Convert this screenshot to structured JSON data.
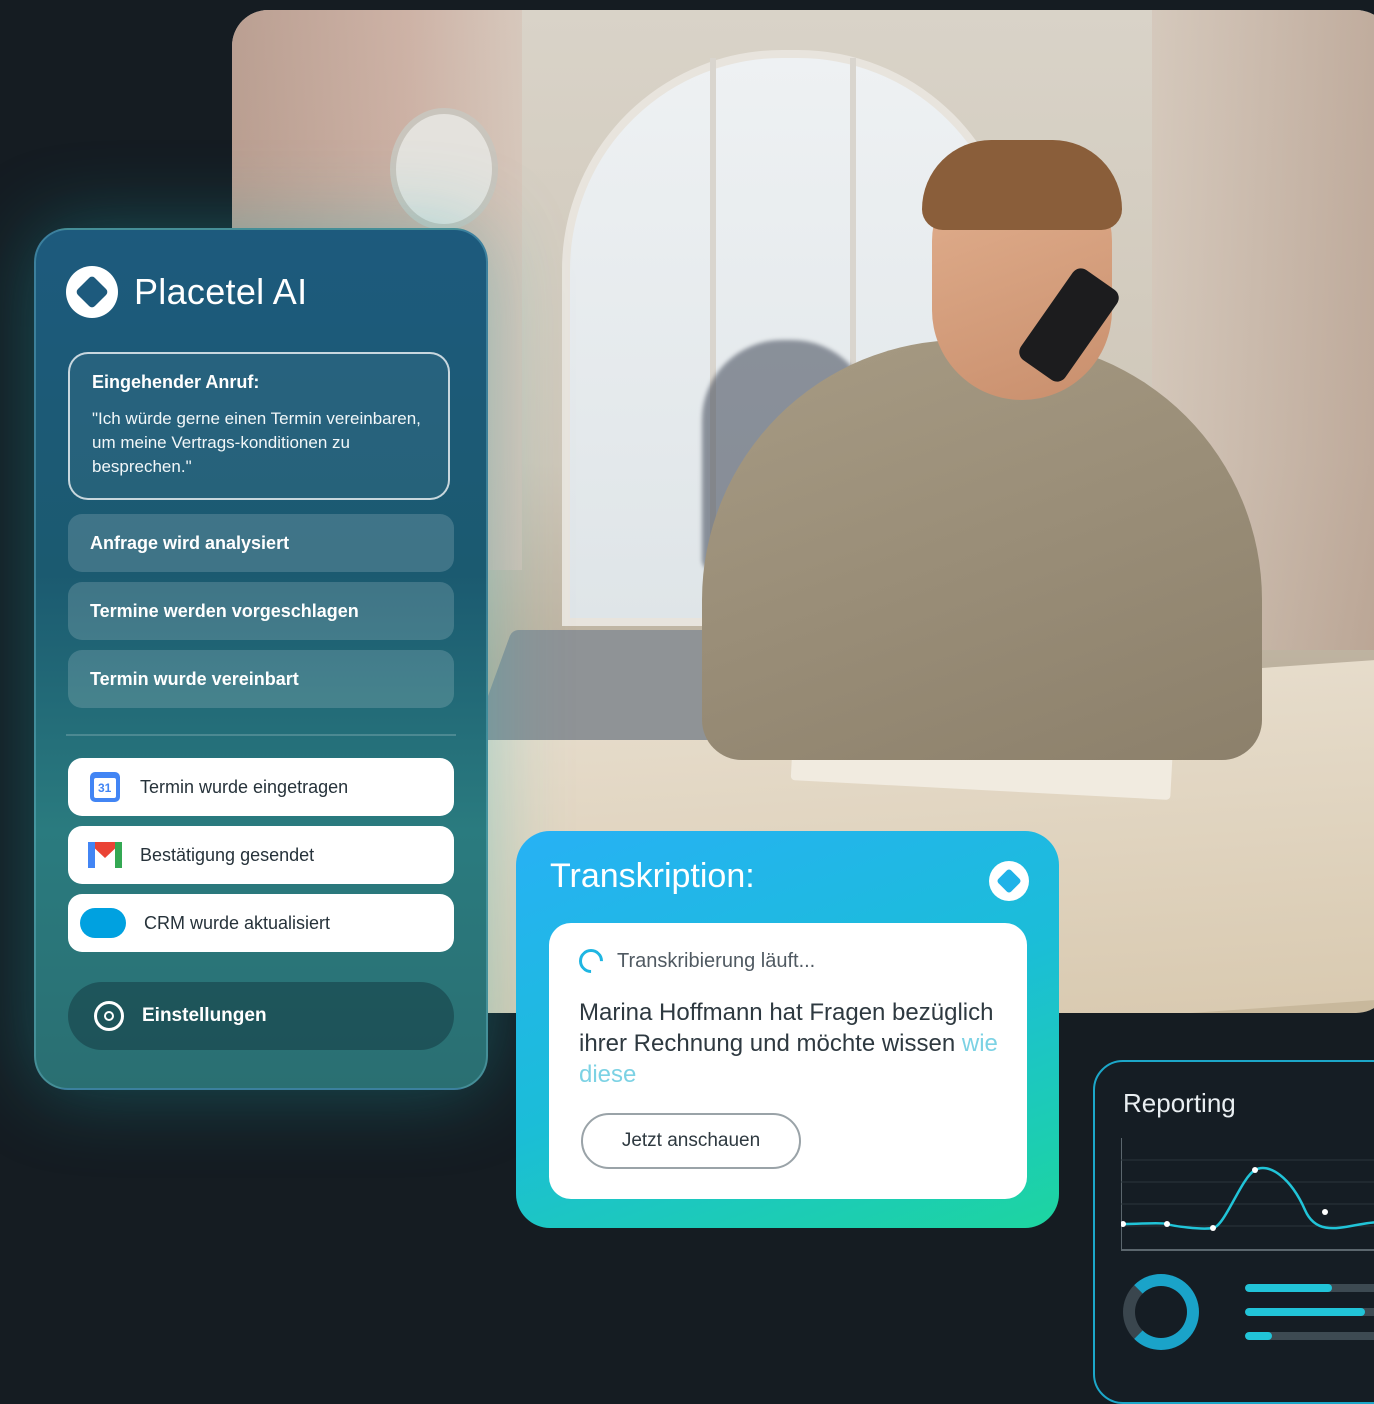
{
  "panel": {
    "title": "Placetel AI",
    "incoming": {
      "title": "Eingehender Anruf:",
      "text": "\"Ich würde gerne einen Termin vereinbaren, um meine Vertrags-konditionen zu besprechen.\""
    },
    "steps": [
      "Anfrage wird analysiert",
      "Termine werden vorgeschlagen",
      "Termin wurde vereinbart"
    ],
    "actions": [
      {
        "label": "Termin wurde eingetragen",
        "icon": "calendar-icon"
      },
      {
        "label": "Bestätigung gesendet",
        "icon": "gmail-icon"
      },
      {
        "label": "CRM wurde aktualisiert",
        "icon": "salesforce-icon"
      }
    ],
    "settings_label": "Einstellungen"
  },
  "transcription": {
    "title": "Transkription:",
    "status": "Transkribierung läuft...",
    "text": "Marina Hoffmann hat Fragen bezüglich ihrer Rechnung und möchte wissen ",
    "text_fading": "wie diese",
    "button_label": "Jetzt anschauen"
  },
  "reporting": {
    "title": "Reporting",
    "bar_levels": [
      0.58,
      0.8,
      0.18
    ]
  },
  "colors": {
    "background": "#151c22",
    "accent_cyan": "#1fb6e2",
    "accent_green": "#1dd5a0"
  }
}
